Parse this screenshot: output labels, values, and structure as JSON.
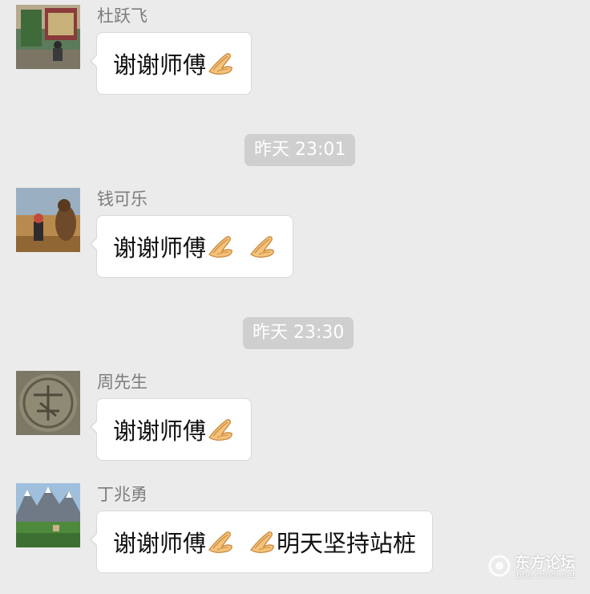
{
  "messages": [
    {
      "sender": "杜跃飞",
      "text_parts": [
        "谢谢师傅"
      ],
      "emoji": [
        "pray-hands-emoji"
      ]
    },
    {
      "sender": "钱可乐",
      "text_parts": [
        "谢谢师傅"
      ],
      "emoji": [
        "pray-hands-emoji",
        "pray-hands-emoji"
      ]
    },
    {
      "sender": "周先生",
      "text_parts": [
        "谢谢师傅"
      ],
      "emoji": [
        "pray-hands-emoji"
      ]
    },
    {
      "sender": "丁兆勇",
      "text_parts": [
        "谢谢师傅",
        "明天坚持站桩"
      ],
      "emoji": [
        "pray-hands-emoji",
        "pray-hands-emoji"
      ]
    }
  ],
  "timestamps": [
    "昨天 23:01",
    "昨天 23:30"
  ],
  "watermark": {
    "title": "东方论坛",
    "url": "bbs.cnool.net"
  },
  "colors": {
    "background": "#ebebeb",
    "bubble": "#ffffff",
    "timestamp_bg": "#cfcfcf",
    "sender_text": "#7d7d7d"
  }
}
